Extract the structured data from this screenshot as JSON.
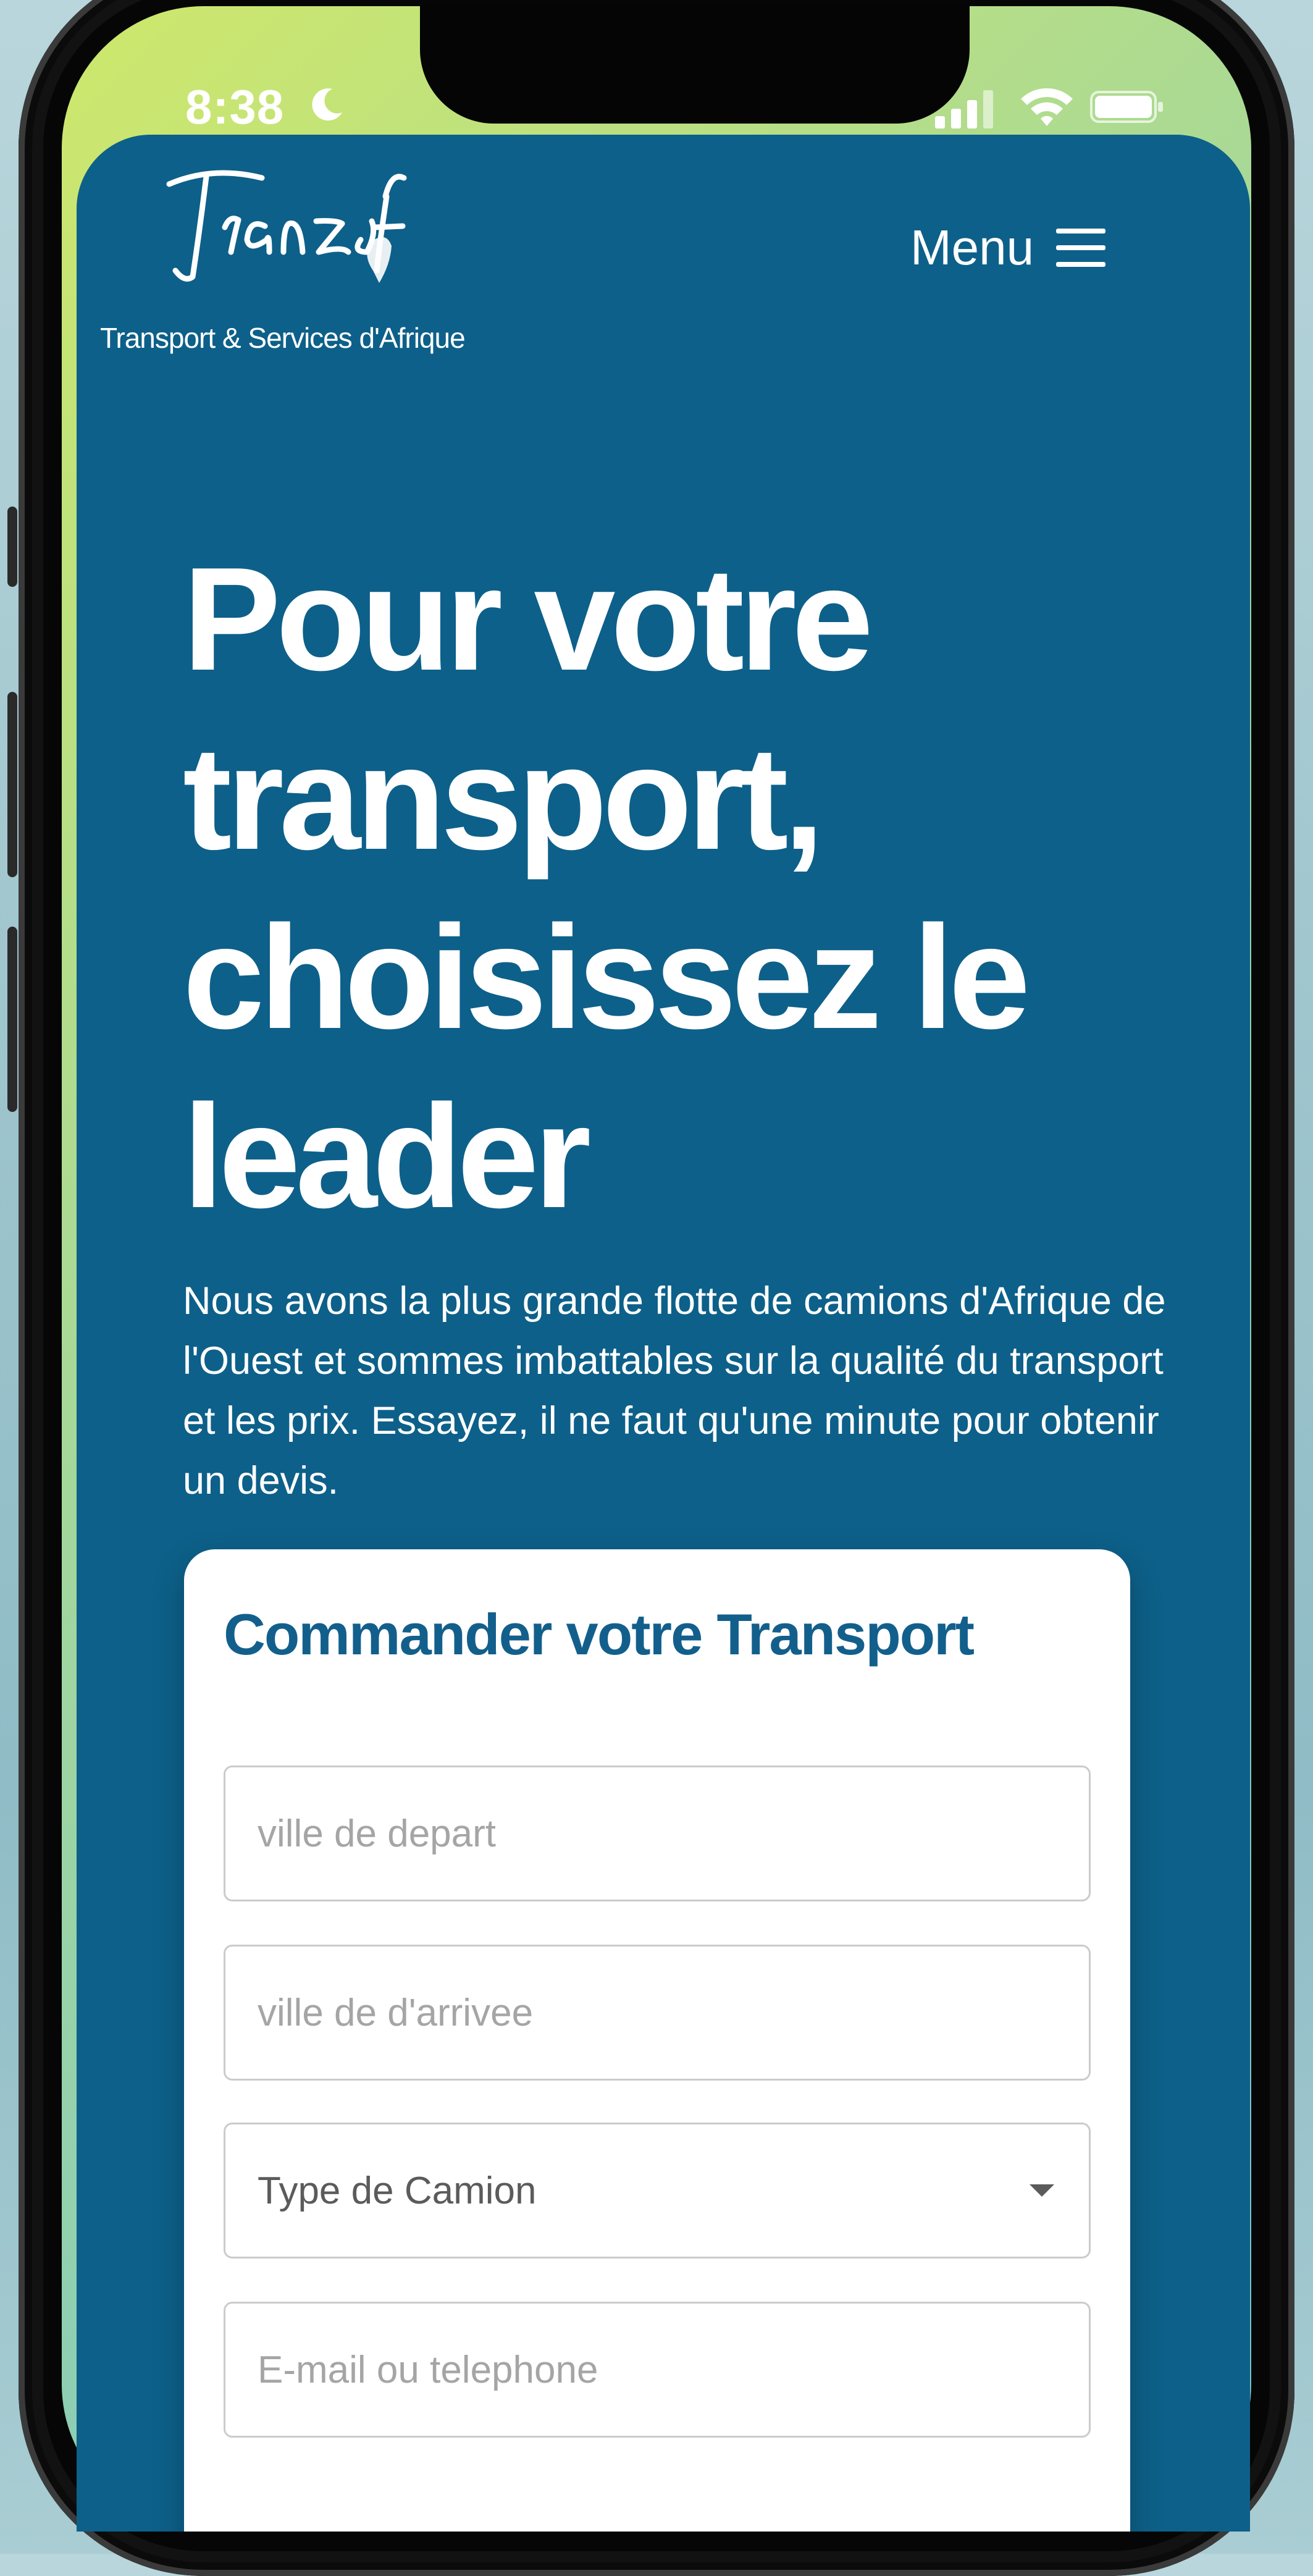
{
  "status_bar": {
    "time": "8:38"
  },
  "header": {
    "logo_text": "Transaf",
    "tagline": "Transport & Services d'Afrique",
    "menu_label": "Menu"
  },
  "hero": {
    "title": "Pour votre transport, choisissez le leader",
    "description": "Nous avons la plus grande flotte de camions d'Afrique de l'Ouest et sommes imbattables sur la qualité du transport et les prix. Essayez, il ne faut qu'une minute pour obtenir un devis."
  },
  "order_form": {
    "title": "Commander votre Transport",
    "departure_placeholder": "ville de depart",
    "arrival_placeholder": "ville de d'arrivee",
    "truck_type_value": "Type de Camion",
    "contact_placeholder": "E-mail ou telephone"
  },
  "colors": {
    "brand_blue": "#0d6089",
    "title_blue": "#135f8c",
    "card_bg": "#ffffff"
  }
}
